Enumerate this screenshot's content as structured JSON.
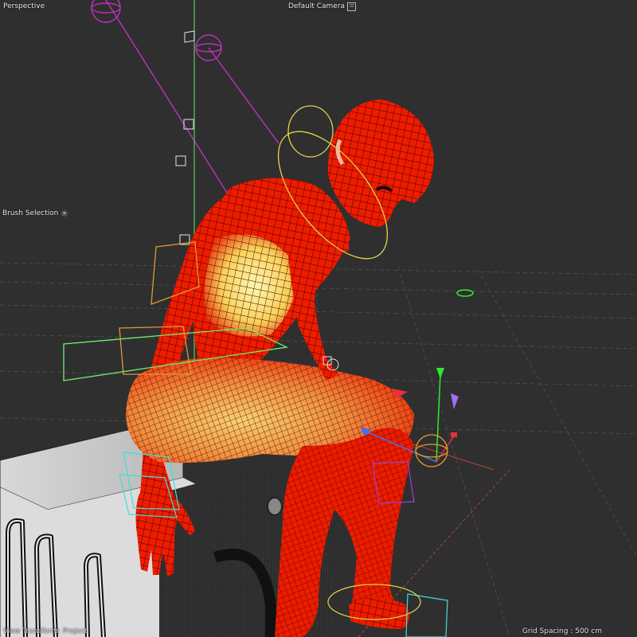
{
  "viewport": {
    "projection_label": "Perspective",
    "camera_label": "Default Camera",
    "camera_icon": "camera-menu-icon",
    "brush_label": "Brush Selection",
    "brush_icon": "dropdown-arrow-icon",
    "view_transform": "View Transform: Project",
    "grid_spacing": "Grid Spacing : 500 cm"
  },
  "colors": {
    "background": "#2f2f2f",
    "mesh_red": "#ee1c00",
    "mesh_yellow": "#f8e070",
    "mesh_wire": "#3a0000",
    "joint_magenta": "#c030c0",
    "control_yellow": "#e2d64a",
    "control_green": "#6ef06e",
    "control_orange": "#e09a30",
    "control_cyan": "#40e0d8",
    "axis_green": "#30e830",
    "axis_red": "#e8303a",
    "axis_blue": "#4a6cf0"
  }
}
